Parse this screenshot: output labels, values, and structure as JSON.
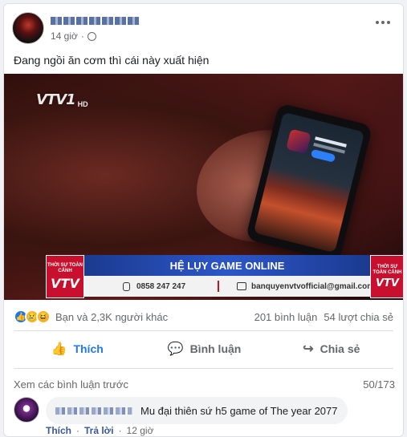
{
  "post": {
    "time": "14 giờ",
    "text": "Đang ngồi ăn cơm thì cái này xuất hiện"
  },
  "media": {
    "channel_logo": "VTV1",
    "hd_badge": "HD",
    "show_name": "THỜI SỰ TOÀN CẢNH",
    "title": "HỆ LỤY GAME ONLINE",
    "phone": "0858 247 247",
    "email": "banquyenvtvofficial@gmail.com",
    "logo_small": "VTV"
  },
  "reactions": {
    "icons": [
      "like-icon",
      "sad-icon",
      "haha-icon"
    ],
    "count_text": "Bạn và 2,3K người khác",
    "comments_text": "201 bình luận",
    "shares_text": "54 lượt chia sẻ"
  },
  "actions": {
    "like": "Thích",
    "comment": "Bình luận",
    "share": "Chia sẻ"
  },
  "comments": {
    "view_previous": "Xem các bình luận trước",
    "counter": "50/173",
    "items": [
      {
        "text": "Mu đại thiên sứ h5 game of The year 2077",
        "like": "Thích",
        "reply": "Trả lời",
        "time": "12 giờ"
      }
    ]
  },
  "colors": {
    "link": "#385898",
    "like_blue": "#1877f2",
    "vtv_red": "#c8102e",
    "banner_blue": "#2c56c8"
  }
}
